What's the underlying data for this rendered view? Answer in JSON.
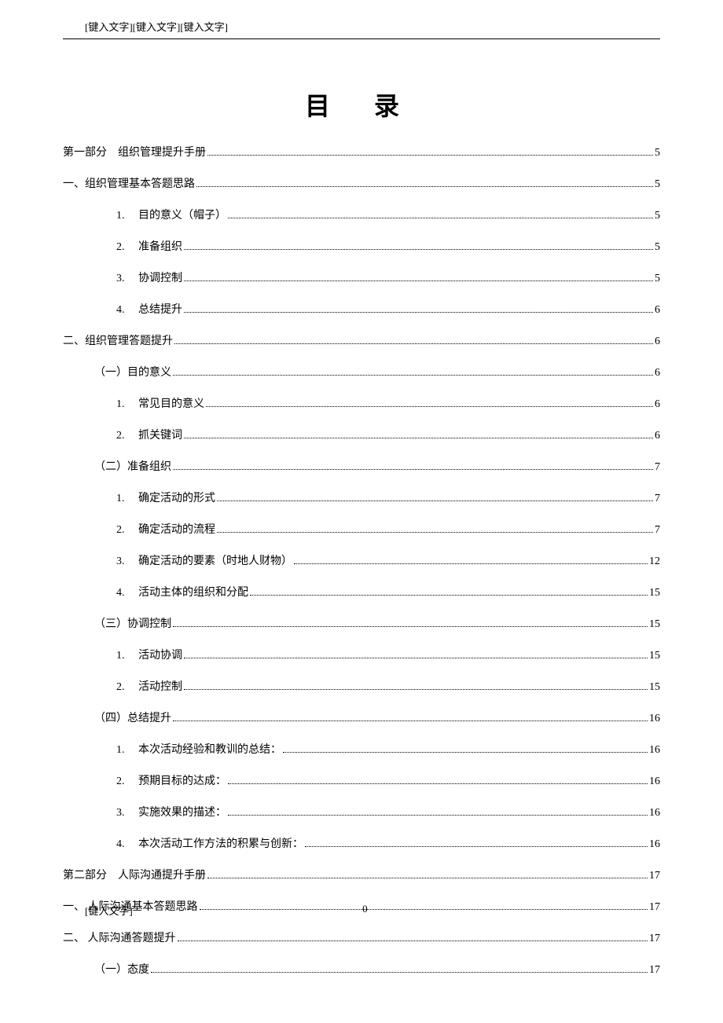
{
  "header": "[键入文字][键入文字][键入文字]",
  "title": "目 录",
  "toc": [
    {
      "indent": 0,
      "num": "",
      "label": "第一部分　组织管理提升手册",
      "page": "5"
    },
    {
      "indent": 0,
      "num": "",
      "label": "一、组织管理基本答题思路",
      "page": "5"
    },
    {
      "indent": 2,
      "num": "1.",
      "label": "目的意义（帽子）",
      "page": "5"
    },
    {
      "indent": 2,
      "num": "2.",
      "label": "准备组织",
      "page": "5"
    },
    {
      "indent": 2,
      "num": "3.",
      "label": "协调控制",
      "page": "5"
    },
    {
      "indent": 2,
      "num": "4.",
      "label": "总结提升",
      "page": "6"
    },
    {
      "indent": 0,
      "num": "",
      "label": "二、组织管理答题提升",
      "page": "6"
    },
    {
      "indent": 1,
      "num": "",
      "label": "（一）目的意义",
      "page": "6"
    },
    {
      "indent": 2,
      "num": "1.",
      "label": "常见目的意义",
      "page": "6"
    },
    {
      "indent": 2,
      "num": "2.",
      "label": "抓关键词",
      "page": "6"
    },
    {
      "indent": 1,
      "num": "",
      "label": "（二）准备组织",
      "page": "7"
    },
    {
      "indent": 2,
      "num": "1.",
      "label": "确定活动的形式",
      "page": "7"
    },
    {
      "indent": 2,
      "num": "2.",
      "label": "确定活动的流程",
      "page": "7"
    },
    {
      "indent": 2,
      "num": "3.",
      "label": "确定活动的要素（时地人财物）",
      "page": "12"
    },
    {
      "indent": 2,
      "num": "4.",
      "label": "活动主体的组织和分配",
      "page": "15"
    },
    {
      "indent": 1,
      "num": "",
      "label": "（三）协调控制",
      "page": "15"
    },
    {
      "indent": 2,
      "num": "1.",
      "label": "活动协调",
      "page": "15"
    },
    {
      "indent": 2,
      "num": "2.",
      "label": "活动控制",
      "page": "15"
    },
    {
      "indent": 1,
      "num": "",
      "label": "（四）总结提升",
      "page": "16"
    },
    {
      "indent": 2,
      "num": "1.",
      "label": "本次活动经验和教训的总结：",
      "page": "16"
    },
    {
      "indent": 2,
      "num": "2.",
      "label": "预期目标的达成：",
      "page": "16"
    },
    {
      "indent": 2,
      "num": "3.",
      "label": "实施效果的描述：",
      "page": "16"
    },
    {
      "indent": 2,
      "num": "4.",
      "label": "本次活动工作方法的积累与创新：",
      "page": "16"
    },
    {
      "indent": 0,
      "num": "",
      "label": "第二部分　人际沟通提升手册",
      "page": "17"
    },
    {
      "indent": 0,
      "num": "",
      "label": "一、 人际沟通基本答题思路",
      "page": "17"
    },
    {
      "indent": 0,
      "num": "",
      "label": "二、 人际沟通答题提升",
      "page": "17"
    },
    {
      "indent": 1,
      "num": "",
      "label": "（一）态度",
      "page": "17"
    }
  ],
  "footer": {
    "left": "[键入文字]",
    "center": "0"
  }
}
